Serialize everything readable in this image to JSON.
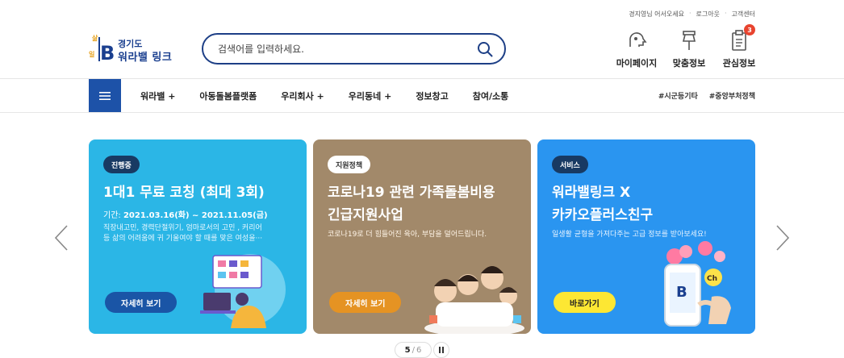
{
  "utility": {
    "items": [
      "경지영님 어서오세요",
      "로그아웃",
      "고객센터"
    ]
  },
  "logo": {
    "line1": "경기도",
    "line2": "워라밸 링크",
    "mark_text": "B"
  },
  "search": {
    "placeholder": "검색어를 입력하세요."
  },
  "quick_links": [
    {
      "label": "마이페이지",
      "icon": "user-head-icon"
    },
    {
      "label": "맞춤정보",
      "icon": "pin-icon"
    },
    {
      "label": "관심정보",
      "icon": "clipboard-icon",
      "badge": "3"
    }
  ],
  "nav": {
    "items": [
      "워라밸 +",
      "아동돌봄플랫폼",
      "우리회사 +",
      "우리동네 +",
      "정보창고",
      "참여/소통"
    ],
    "tags": [
      "#시군등기타",
      "#중앙부처정책"
    ]
  },
  "slides": [
    {
      "chip": "진행중",
      "title_lines": [
        "1대1 무료 코칭 (최대 3회)"
      ],
      "period_label": "기간:",
      "period": "2021.03.16(화) ~ 2021.11.05(금)",
      "desc_lines": [
        "직장내고민, 경력단절위기, 엄마로서의 고민 , 커리어",
        "등 삶의 어려움에 귀 기울여야 할 때를 맞은 여성을···"
      ],
      "button": "자세히 보기",
      "bg": "#2bb6e6"
    },
    {
      "chip": "지원정책",
      "title_lines": [
        "코로나19 관련 가족돌봄비용",
        "긴급지원사업"
      ],
      "desc_lines": [
        "코로나19로 더 힘들어진 육아, 부담을 덜어드립니다."
      ],
      "button": "자세히 보기",
      "bg": "#a2896a"
    },
    {
      "chip": "서비스",
      "title_lines": [
        "워라밸링크 X",
        "카카오플러스친구"
      ],
      "desc_lines": [
        "일생활 균형을 가져다주는 고급 정보를 받아보세요!"
      ],
      "button": "바로가기",
      "bg": "#2a95f0"
    }
  ],
  "pager": {
    "current": "5",
    "sep": "/",
    "total": "6"
  }
}
